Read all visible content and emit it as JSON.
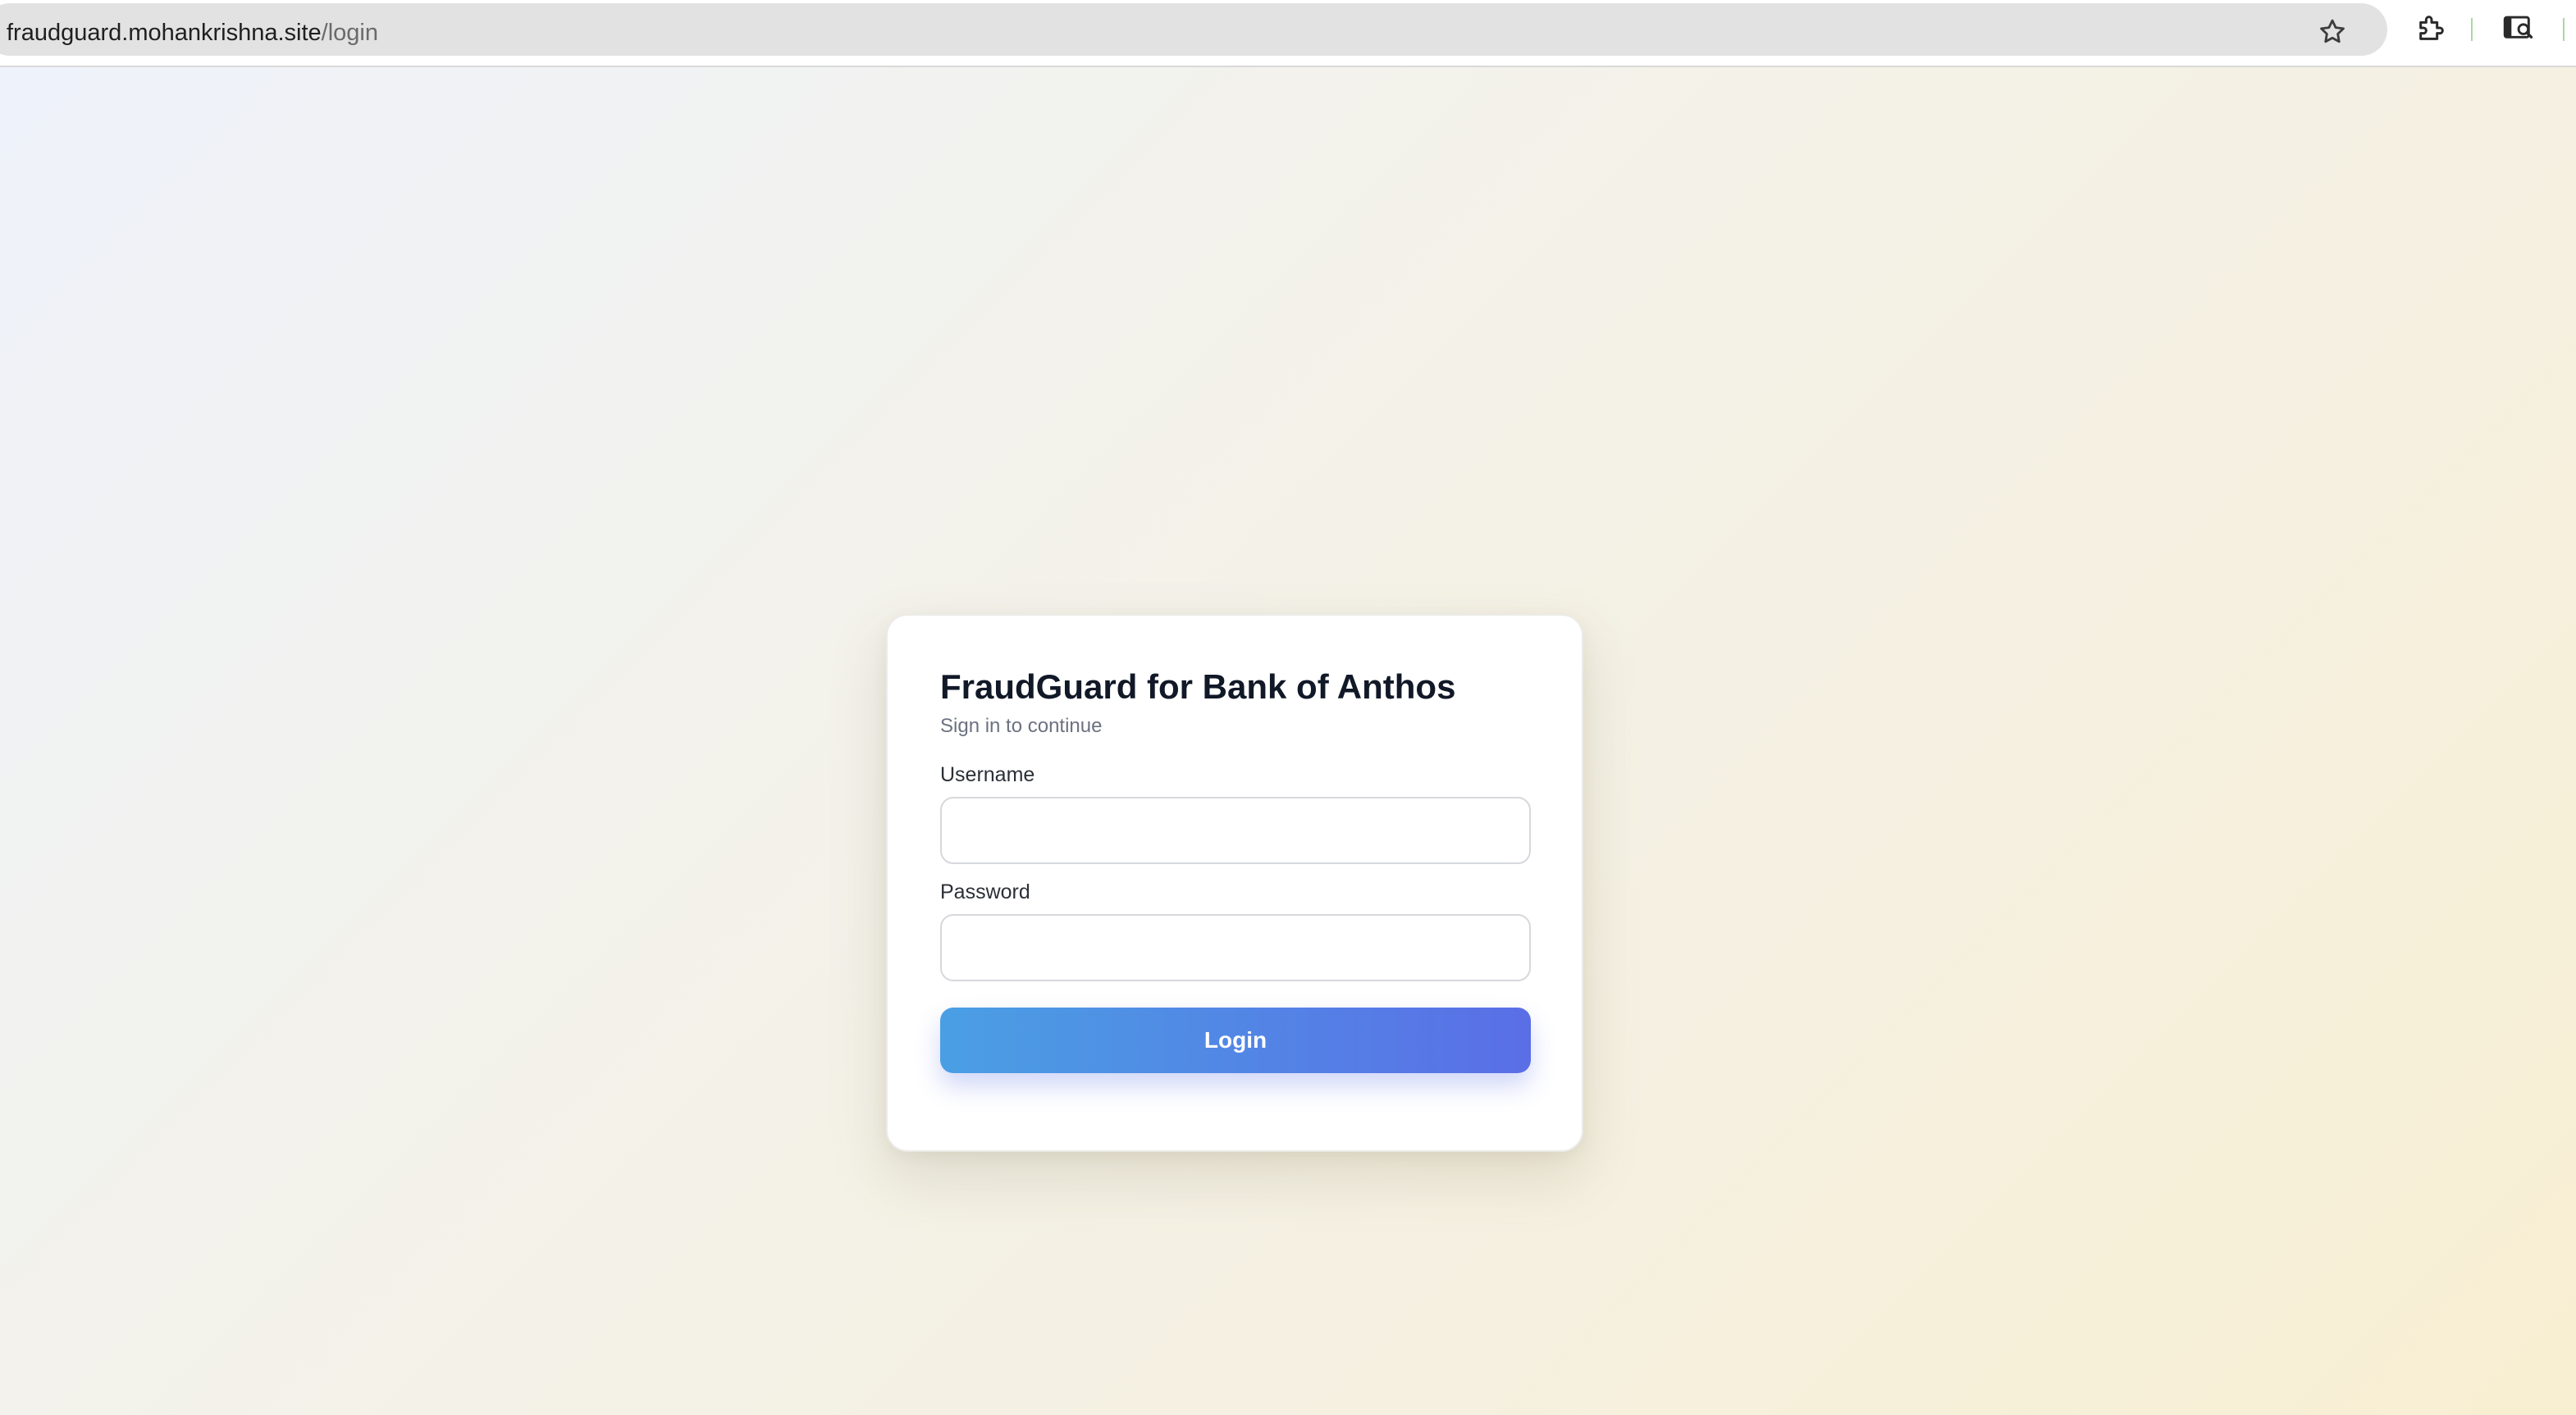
{
  "browser": {
    "url_host": "fraudguard.mohankrishna.site",
    "url_path": "/login",
    "icons": [
      "star-icon",
      "extensions-icon",
      "cast-icon"
    ]
  },
  "login": {
    "title": "FraudGuard for Bank of Anthos",
    "subtitle": "Sign in to continue",
    "username_label": "Username",
    "username_value": "",
    "password_label": "Password",
    "password_value": "",
    "submit_label": "Login"
  },
  "colors": {
    "button_gradient_start": "#4a9fe4",
    "button_gradient_end": "#5a6ee6",
    "title": "#111827",
    "subtitle": "#6b7280"
  }
}
